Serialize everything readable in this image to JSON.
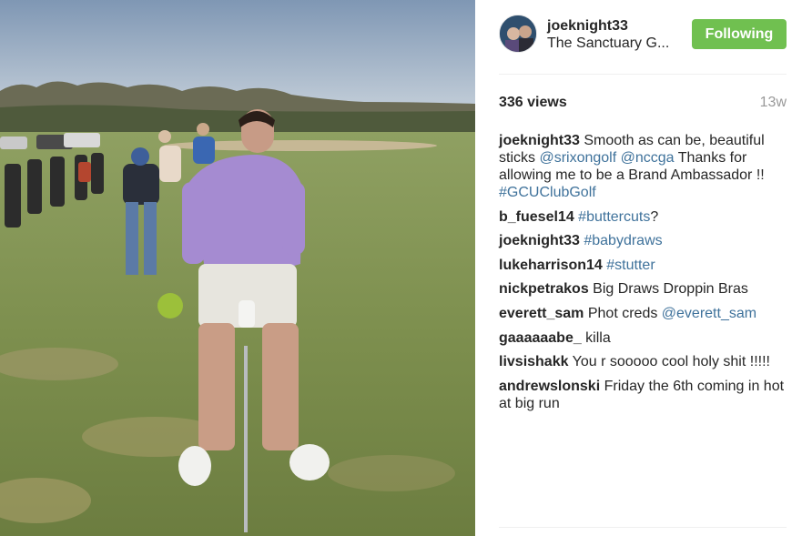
{
  "post": {
    "owner": "joeknight33",
    "location": "The Sanctuary G...",
    "follow_label": "Following",
    "views": "336 views",
    "age": "13w"
  },
  "comments": [
    {
      "user": "joeknight33",
      "parts": [
        {
          "t": "text",
          "v": " Smooth as can be, beautiful sticks "
        },
        {
          "t": "link",
          "v": "@srixongolf"
        },
        {
          "t": "text",
          "v": " "
        },
        {
          "t": "link",
          "v": "@nccga"
        },
        {
          "t": "text",
          "v": " Thanks for allowing me to be a Brand Ambassador !! "
        },
        {
          "t": "link",
          "v": "#GCUClubGolf"
        }
      ]
    },
    {
      "user": "b_fuesel14",
      "parts": [
        {
          "t": "text",
          "v": " "
        },
        {
          "t": "link",
          "v": "#buttercuts"
        },
        {
          "t": "text",
          "v": "?"
        }
      ]
    },
    {
      "user": "joeknight33",
      "parts": [
        {
          "t": "text",
          "v": " "
        },
        {
          "t": "link",
          "v": "#babydraws"
        }
      ]
    },
    {
      "user": "lukeharrison14",
      "parts": [
        {
          "t": "text",
          "v": " "
        },
        {
          "t": "link",
          "v": "#stutter"
        }
      ]
    },
    {
      "user": "nickpetrakos",
      "parts": [
        {
          "t": "text",
          "v": " Big Draws Droppin Bras"
        }
      ]
    },
    {
      "user": "everett_sam",
      "parts": [
        {
          "t": "text",
          "v": " Phot creds "
        },
        {
          "t": "link",
          "v": "@everett_sam"
        }
      ]
    },
    {
      "user": "gaaaaaabe_",
      "parts": [
        {
          "t": "text",
          "v": " killa"
        }
      ]
    },
    {
      "user": "livsishakk",
      "parts": [
        {
          "t": "text",
          "v": " You r sooooo cool holy shit !!!!!"
        }
      ]
    },
    {
      "user": "andrewslonski",
      "parts": [
        {
          "t": "text",
          "v": " Friday the 6th coming in hot at big run"
        }
      ]
    }
  ],
  "colors": {
    "follow_button": "#70c050",
    "link": "#3f729b",
    "muted": "#999999",
    "text": "#262626"
  }
}
